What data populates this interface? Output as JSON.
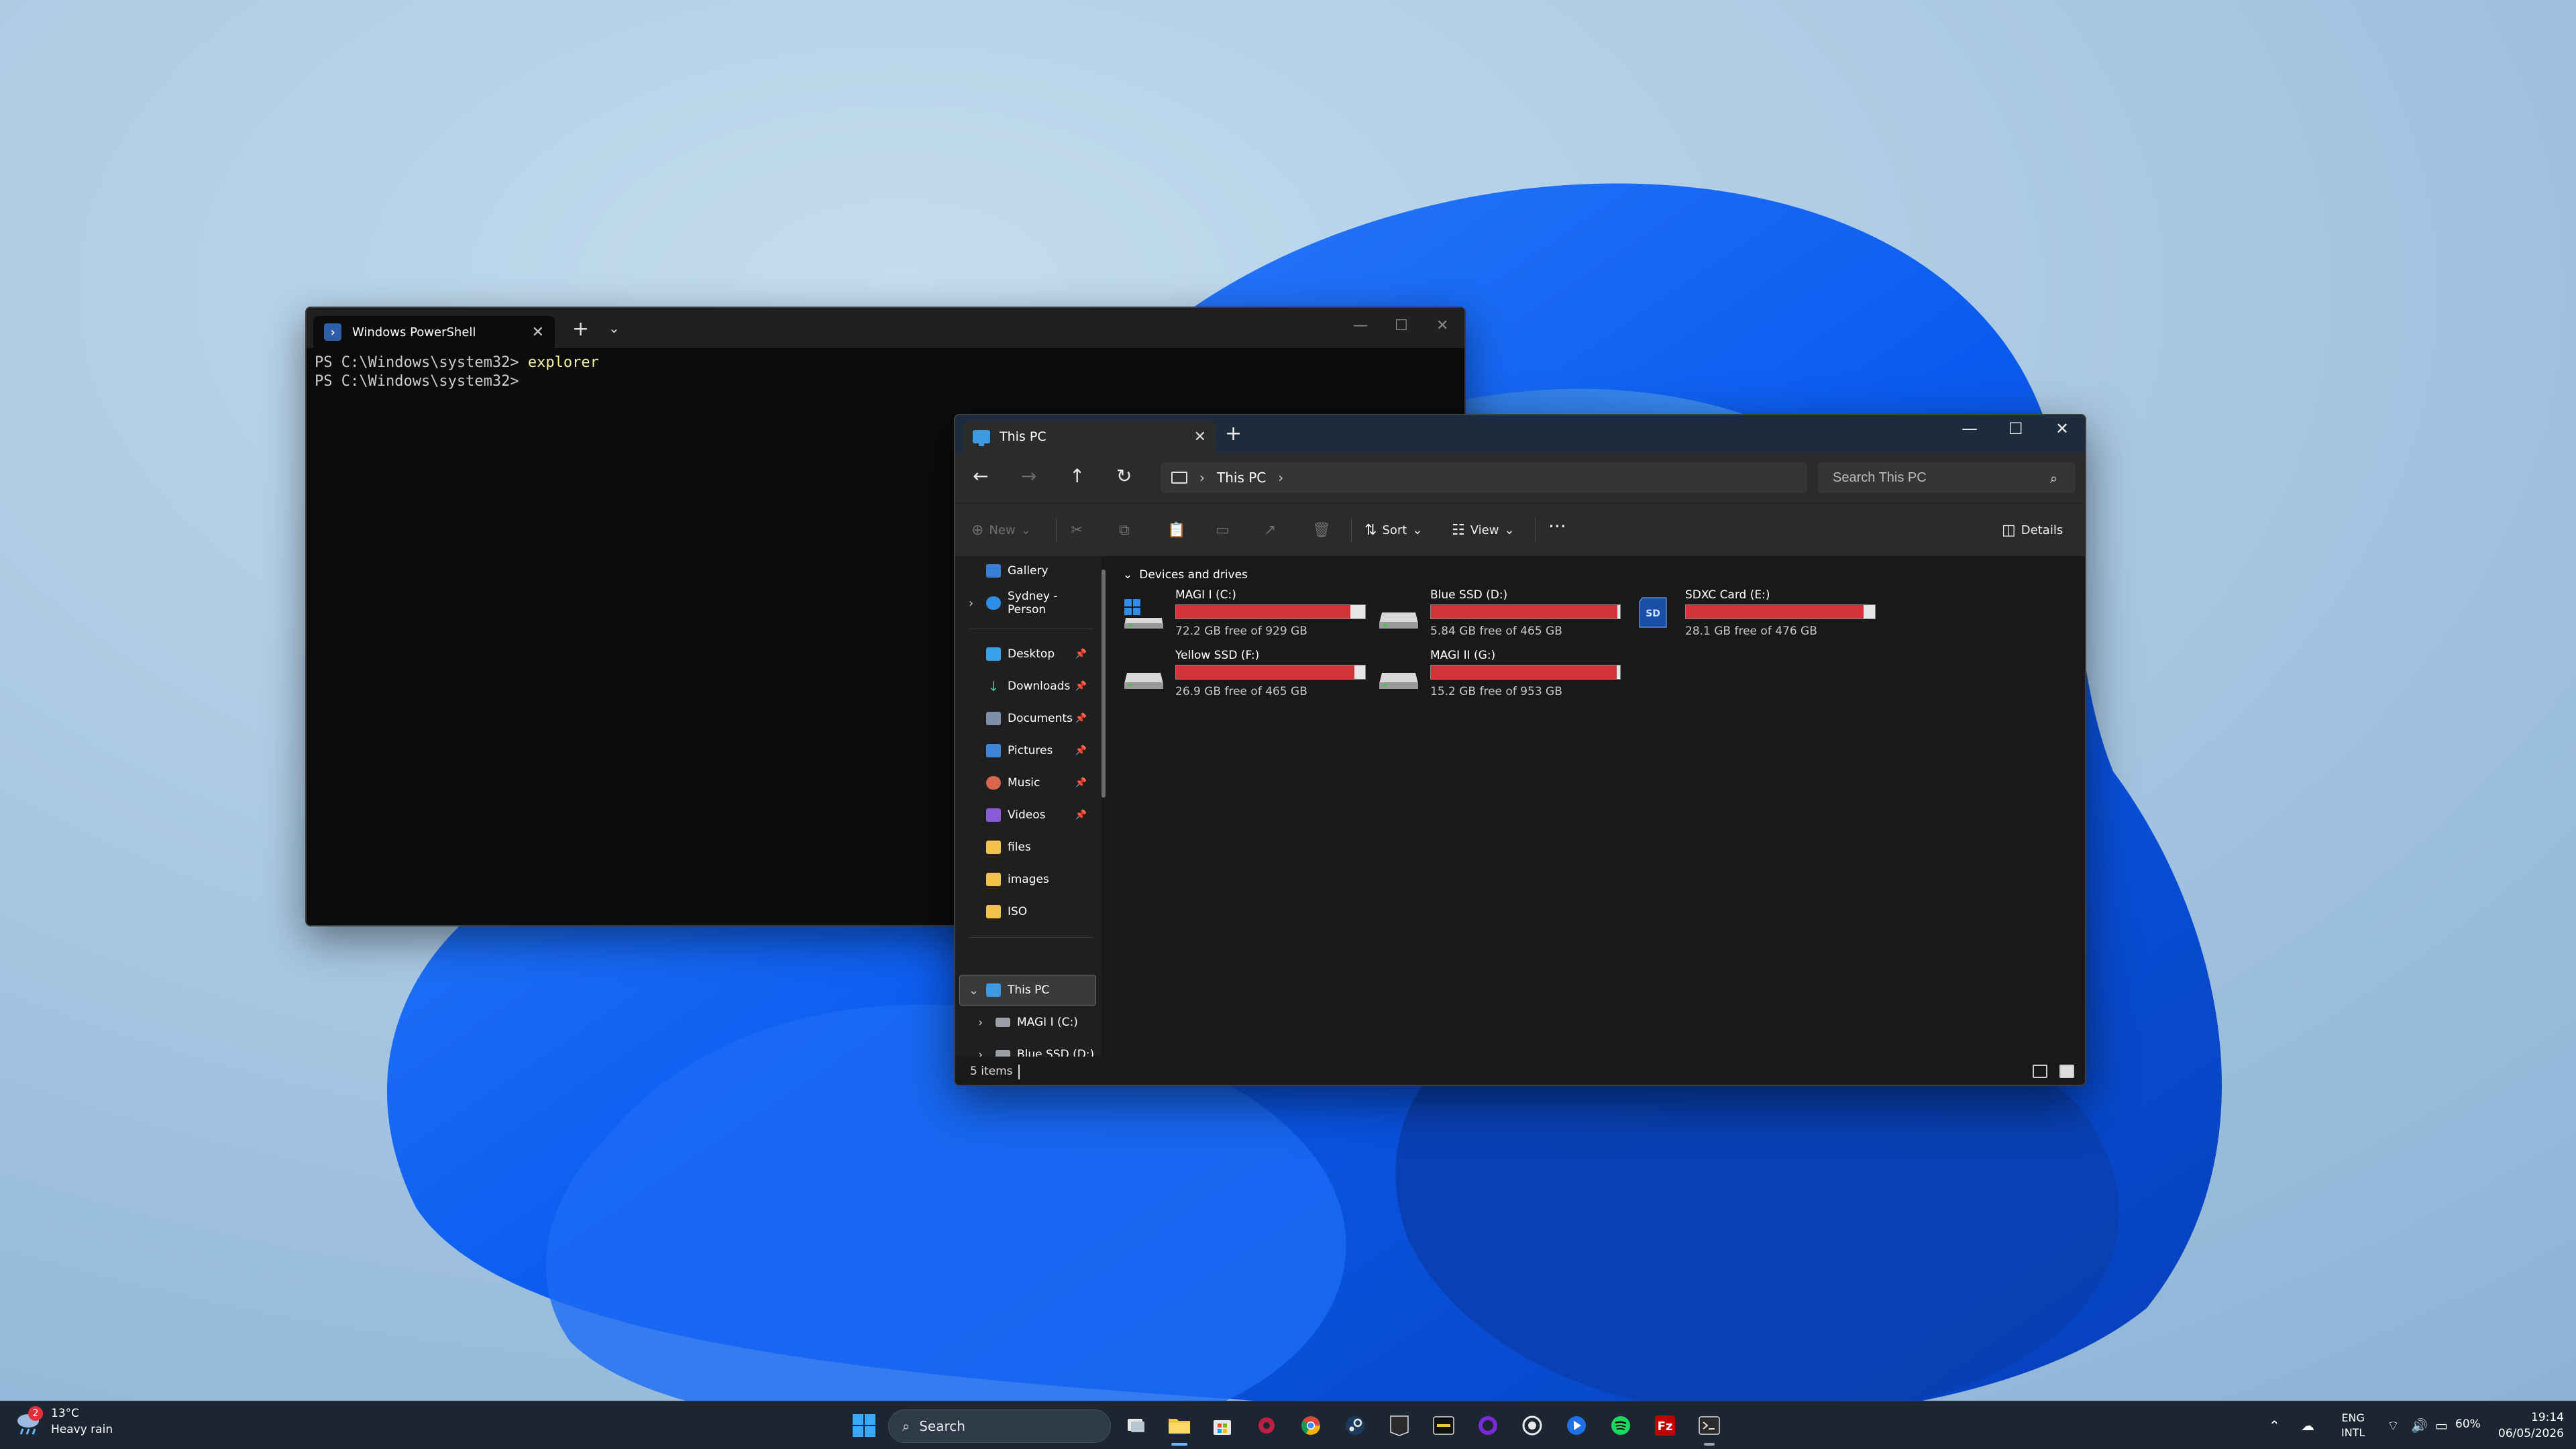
{
  "powershell": {
    "tab_title": "Windows PowerShell",
    "lines": [
      {
        "prompt": "PS C:\\Windows\\system32>",
        "command": " explorer"
      },
      {
        "prompt": "PS C:\\Windows\\system32>",
        "command": ""
      }
    ]
  },
  "explorer": {
    "tab_title": "This PC",
    "address": {
      "location": "This PC"
    },
    "search": {
      "placeholder": "Search This PC"
    },
    "toolbar": {
      "new_label": "New",
      "sort_label": "Sort",
      "view_label": "View",
      "more_label": "···",
      "details_label": "Details"
    },
    "sidebar": {
      "items": [
        {
          "label": "Gallery"
        },
        {
          "label": "Sydney - Person"
        },
        {
          "label": "Desktop"
        },
        {
          "label": "Downloads"
        },
        {
          "label": "Documents"
        },
        {
          "label": "Pictures"
        },
        {
          "label": "Music"
        },
        {
          "label": "Videos"
        },
        {
          "label": "files"
        },
        {
          "label": "images"
        },
        {
          "label": "ISO"
        },
        {
          "label": "This PC"
        },
        {
          "label": "MAGI I (C:)"
        },
        {
          "label": "Blue SSD (D:)"
        }
      ]
    },
    "content": {
      "group_header": "Devices and drives",
      "drives": [
        {
          "name": "MAGI I (C:)",
          "free_text": "72.2 GB free of 929 GB",
          "used_fraction": 0.922
        },
        {
          "name": "Blue SSD (D:)",
          "free_text": "5.84 GB free of 465 GB",
          "used_fraction": 0.987
        },
        {
          "name": "SDXC Card (E:)",
          "free_text": "28.1 GB free of 476 GB",
          "used_fraction": 0.941
        },
        {
          "name": "Yellow SSD (F:)",
          "free_text": "26.9 GB free of 465 GB",
          "used_fraction": 0.942
        },
        {
          "name": "MAGI II (G:)",
          "free_text": "15.2 GB free of 953 GB",
          "used_fraction": 0.984
        }
      ]
    },
    "status": {
      "items_text": "5 items"
    }
  },
  "taskbar": {
    "weather": {
      "temp": "13°C",
      "desc": "Heavy rain",
      "badge": "2"
    },
    "search_label": "Search",
    "tray": {
      "lang_line1": "ENG",
      "lang_line2": "INTL",
      "battery": "60%"
    },
    "clock": {
      "time": "19:14",
      "date": "06/05/2026"
    }
  },
  "colors": {
    "drive_bar_fill": "#d13438",
    "accent": "#3c9be0"
  }
}
